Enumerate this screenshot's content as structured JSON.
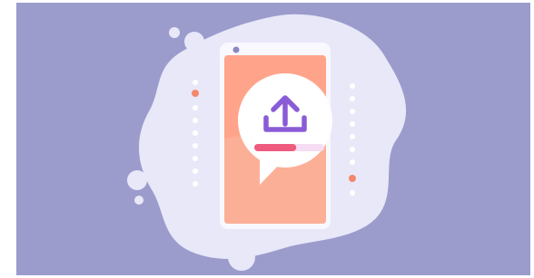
{
  "illustration": {
    "subject": "upload-illustration",
    "colors": {
      "background": "#9b9ccc",
      "blob": "#e8e8f9",
      "phone_frame": "#f8f8fe",
      "screen_top": "#ffa48a",
      "screen_bottom": "#fbb39c",
      "bubble": "#ffffff",
      "upload_icon": "#8a5bd6",
      "progress_track": "#f6ddf4",
      "progress_fill": "#ef5b7f",
      "dot_white": "#ffffff",
      "dot_accent": "#f3876c"
    },
    "progress_fraction": 0.6
  }
}
